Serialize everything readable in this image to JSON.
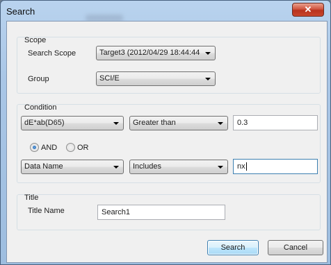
{
  "window": {
    "title": "Search",
    "close_glyph": "✕"
  },
  "scope": {
    "label": "Scope",
    "search_scope_label": "Search Scope",
    "search_scope_value": "Target3 (2012/04/29 18:44:44",
    "group_label": "Group",
    "group_value": "SCI/E"
  },
  "condition": {
    "label": "Condition",
    "row1": {
      "field": "dE*ab(D65)",
      "operator": "Greater than",
      "value": "0.3"
    },
    "and_label": "AND",
    "or_label": "OR",
    "selected_logic": "AND",
    "row2": {
      "field": "Data Name",
      "operator": "Includes",
      "value": "nx"
    }
  },
  "title_section": {
    "label": "Title",
    "title_name_label": "Title Name",
    "title_name_value": "Search1"
  },
  "buttons": {
    "search": "Search",
    "cancel": "Cancel"
  }
}
